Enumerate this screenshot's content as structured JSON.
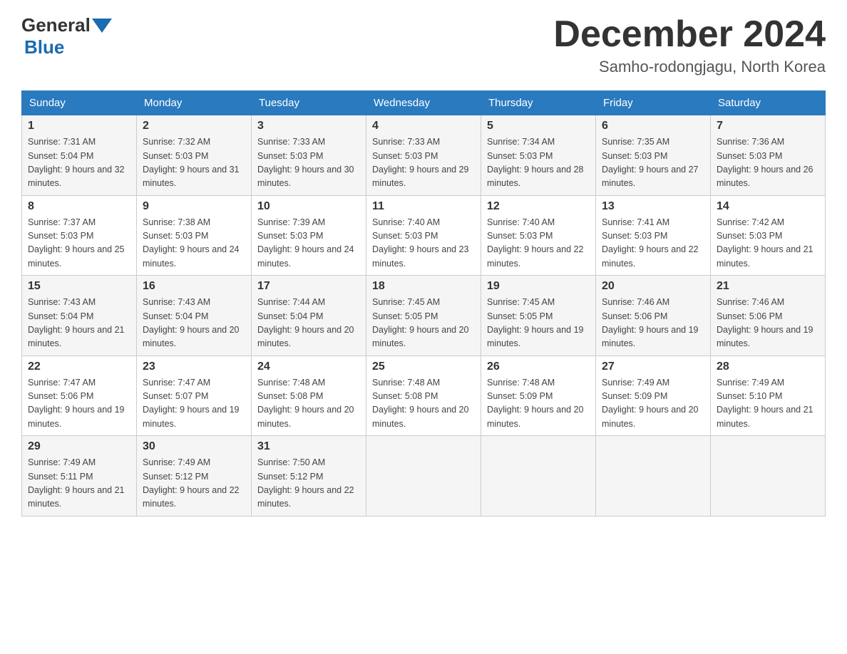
{
  "header": {
    "logo_general": "General",
    "logo_blue": "Blue",
    "month_title": "December 2024",
    "location": "Samho-rodongjagu, North Korea"
  },
  "columns": [
    "Sunday",
    "Monday",
    "Tuesday",
    "Wednesday",
    "Thursday",
    "Friday",
    "Saturday"
  ],
  "weeks": [
    [
      {
        "day": "1",
        "sunrise": "Sunrise: 7:31 AM",
        "sunset": "Sunset: 5:04 PM",
        "daylight": "Daylight: 9 hours and 32 minutes."
      },
      {
        "day": "2",
        "sunrise": "Sunrise: 7:32 AM",
        "sunset": "Sunset: 5:03 PM",
        "daylight": "Daylight: 9 hours and 31 minutes."
      },
      {
        "day": "3",
        "sunrise": "Sunrise: 7:33 AM",
        "sunset": "Sunset: 5:03 PM",
        "daylight": "Daylight: 9 hours and 30 minutes."
      },
      {
        "day": "4",
        "sunrise": "Sunrise: 7:33 AM",
        "sunset": "Sunset: 5:03 PM",
        "daylight": "Daylight: 9 hours and 29 minutes."
      },
      {
        "day": "5",
        "sunrise": "Sunrise: 7:34 AM",
        "sunset": "Sunset: 5:03 PM",
        "daylight": "Daylight: 9 hours and 28 minutes."
      },
      {
        "day": "6",
        "sunrise": "Sunrise: 7:35 AM",
        "sunset": "Sunset: 5:03 PM",
        "daylight": "Daylight: 9 hours and 27 minutes."
      },
      {
        "day": "7",
        "sunrise": "Sunrise: 7:36 AM",
        "sunset": "Sunset: 5:03 PM",
        "daylight": "Daylight: 9 hours and 26 minutes."
      }
    ],
    [
      {
        "day": "8",
        "sunrise": "Sunrise: 7:37 AM",
        "sunset": "Sunset: 5:03 PM",
        "daylight": "Daylight: 9 hours and 25 minutes."
      },
      {
        "day": "9",
        "sunrise": "Sunrise: 7:38 AM",
        "sunset": "Sunset: 5:03 PM",
        "daylight": "Daylight: 9 hours and 24 minutes."
      },
      {
        "day": "10",
        "sunrise": "Sunrise: 7:39 AM",
        "sunset": "Sunset: 5:03 PM",
        "daylight": "Daylight: 9 hours and 24 minutes."
      },
      {
        "day": "11",
        "sunrise": "Sunrise: 7:40 AM",
        "sunset": "Sunset: 5:03 PM",
        "daylight": "Daylight: 9 hours and 23 minutes."
      },
      {
        "day": "12",
        "sunrise": "Sunrise: 7:40 AM",
        "sunset": "Sunset: 5:03 PM",
        "daylight": "Daylight: 9 hours and 22 minutes."
      },
      {
        "day": "13",
        "sunrise": "Sunrise: 7:41 AM",
        "sunset": "Sunset: 5:03 PM",
        "daylight": "Daylight: 9 hours and 22 minutes."
      },
      {
        "day": "14",
        "sunrise": "Sunrise: 7:42 AM",
        "sunset": "Sunset: 5:03 PM",
        "daylight": "Daylight: 9 hours and 21 minutes."
      }
    ],
    [
      {
        "day": "15",
        "sunrise": "Sunrise: 7:43 AM",
        "sunset": "Sunset: 5:04 PM",
        "daylight": "Daylight: 9 hours and 21 minutes."
      },
      {
        "day": "16",
        "sunrise": "Sunrise: 7:43 AM",
        "sunset": "Sunset: 5:04 PM",
        "daylight": "Daylight: 9 hours and 20 minutes."
      },
      {
        "day": "17",
        "sunrise": "Sunrise: 7:44 AM",
        "sunset": "Sunset: 5:04 PM",
        "daylight": "Daylight: 9 hours and 20 minutes."
      },
      {
        "day": "18",
        "sunrise": "Sunrise: 7:45 AM",
        "sunset": "Sunset: 5:05 PM",
        "daylight": "Daylight: 9 hours and 20 minutes."
      },
      {
        "day": "19",
        "sunrise": "Sunrise: 7:45 AM",
        "sunset": "Sunset: 5:05 PM",
        "daylight": "Daylight: 9 hours and 19 minutes."
      },
      {
        "day": "20",
        "sunrise": "Sunrise: 7:46 AM",
        "sunset": "Sunset: 5:06 PM",
        "daylight": "Daylight: 9 hours and 19 minutes."
      },
      {
        "day": "21",
        "sunrise": "Sunrise: 7:46 AM",
        "sunset": "Sunset: 5:06 PM",
        "daylight": "Daylight: 9 hours and 19 minutes."
      }
    ],
    [
      {
        "day": "22",
        "sunrise": "Sunrise: 7:47 AM",
        "sunset": "Sunset: 5:06 PM",
        "daylight": "Daylight: 9 hours and 19 minutes."
      },
      {
        "day": "23",
        "sunrise": "Sunrise: 7:47 AM",
        "sunset": "Sunset: 5:07 PM",
        "daylight": "Daylight: 9 hours and 19 minutes."
      },
      {
        "day": "24",
        "sunrise": "Sunrise: 7:48 AM",
        "sunset": "Sunset: 5:08 PM",
        "daylight": "Daylight: 9 hours and 20 minutes."
      },
      {
        "day": "25",
        "sunrise": "Sunrise: 7:48 AM",
        "sunset": "Sunset: 5:08 PM",
        "daylight": "Daylight: 9 hours and 20 minutes."
      },
      {
        "day": "26",
        "sunrise": "Sunrise: 7:48 AM",
        "sunset": "Sunset: 5:09 PM",
        "daylight": "Daylight: 9 hours and 20 minutes."
      },
      {
        "day": "27",
        "sunrise": "Sunrise: 7:49 AM",
        "sunset": "Sunset: 5:09 PM",
        "daylight": "Daylight: 9 hours and 20 minutes."
      },
      {
        "day": "28",
        "sunrise": "Sunrise: 7:49 AM",
        "sunset": "Sunset: 5:10 PM",
        "daylight": "Daylight: 9 hours and 21 minutes."
      }
    ],
    [
      {
        "day": "29",
        "sunrise": "Sunrise: 7:49 AM",
        "sunset": "Sunset: 5:11 PM",
        "daylight": "Daylight: 9 hours and 21 minutes."
      },
      {
        "day": "30",
        "sunrise": "Sunrise: 7:49 AM",
        "sunset": "Sunset: 5:12 PM",
        "daylight": "Daylight: 9 hours and 22 minutes."
      },
      {
        "day": "31",
        "sunrise": "Sunrise: 7:50 AM",
        "sunset": "Sunset: 5:12 PM",
        "daylight": "Daylight: 9 hours and 22 minutes."
      },
      null,
      null,
      null,
      null
    ]
  ]
}
